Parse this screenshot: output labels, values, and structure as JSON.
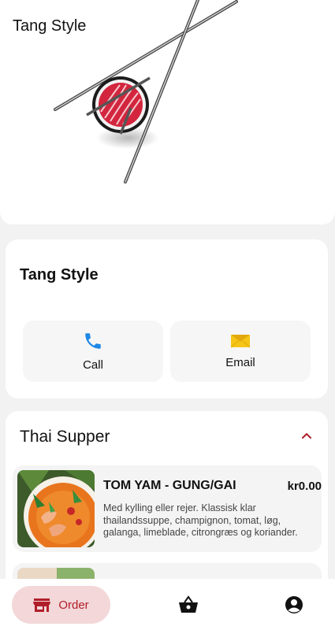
{
  "header": {
    "title": "Tang Style"
  },
  "info": {
    "title": "Tang Style",
    "call_label": "Call",
    "email_label": "Email"
  },
  "menu": {
    "section_title": "Thai Supper",
    "dishes": [
      {
        "name": "TOM YAM - GUNG/GAI",
        "price": "kr0.00",
        "description": "Med kylling eller rejer. Klassisk klar thailandssuppe, champignon, tomat, løg, galanga, limeblade, citrongræs og koriander."
      },
      {
        "name": "",
        "price": "",
        "description": ""
      }
    ]
  },
  "bottom_nav": {
    "order_label": "Order"
  },
  "colors": {
    "accent": "#b01e2a",
    "accent_bg": "#f3d7d9",
    "call_icon": "#1e88e5"
  }
}
